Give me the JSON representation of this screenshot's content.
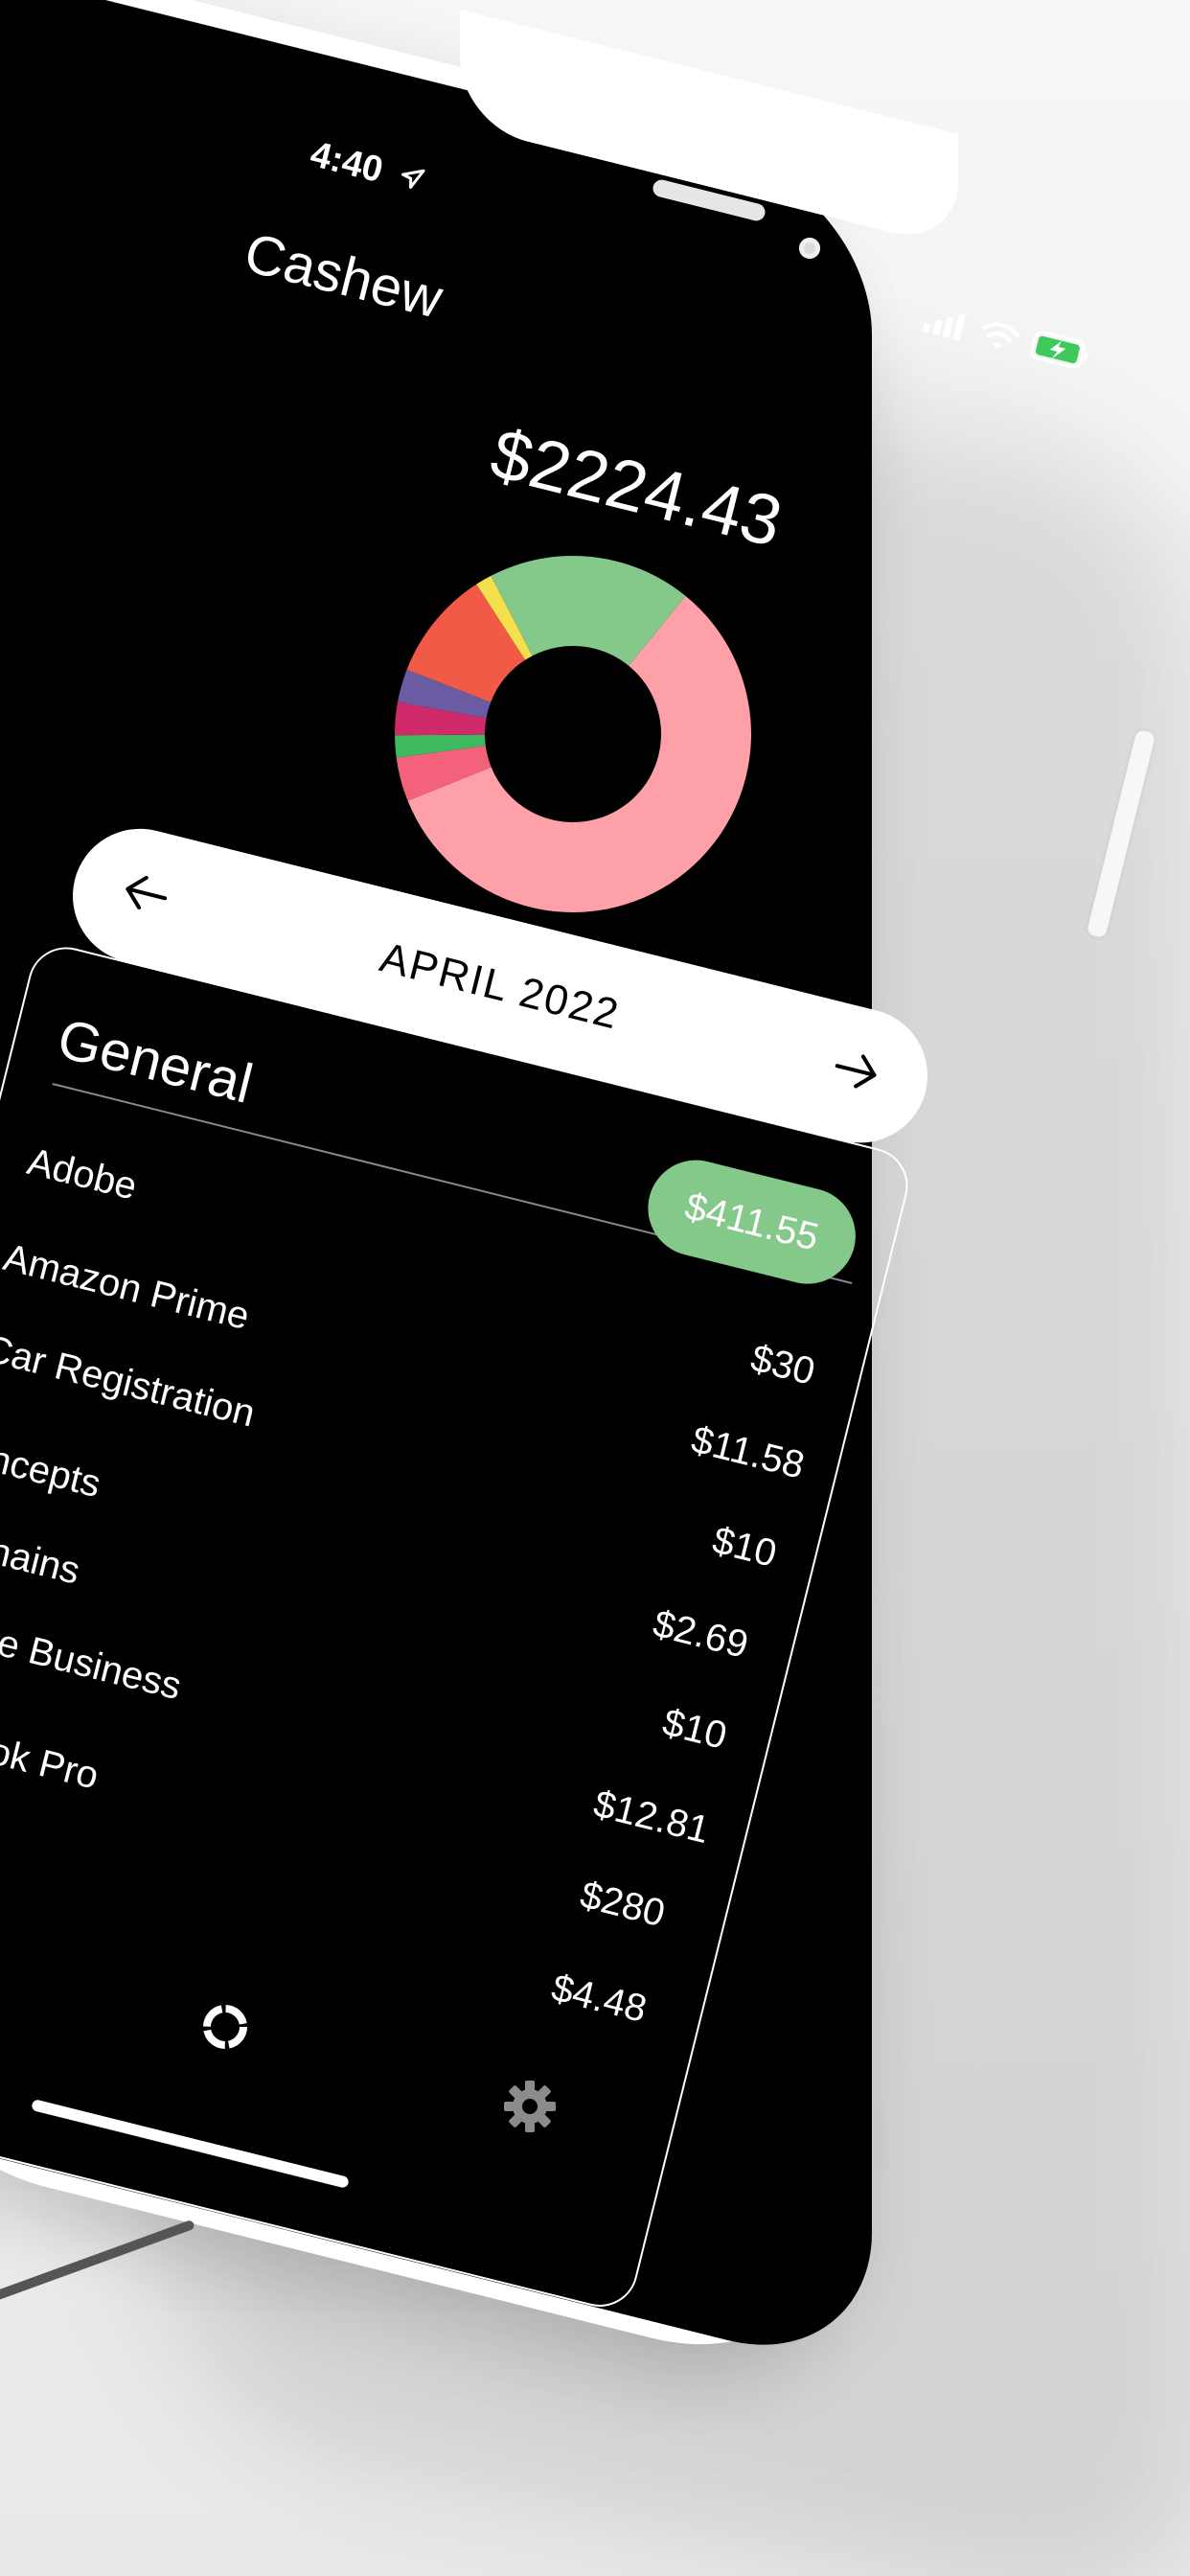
{
  "status": {
    "time": "4:40"
  },
  "app": {
    "title": "Cashew"
  },
  "summary": {
    "total": "$2224.43"
  },
  "month_nav": {
    "label": "APRIL 2022"
  },
  "category": {
    "title": "General"
  },
  "selected_amount": "$411.55",
  "rows": [
    {
      "name": "Adobe",
      "amount": "$30"
    },
    {
      "name": "Amazon Prime",
      "amount": "$11.58"
    },
    {
      "name": "Car Registration",
      "amount": "$10"
    },
    {
      "name": "ncepts",
      "amount": "$2.69"
    },
    {
      "name": "nains",
      "amount": "$10"
    },
    {
      "name": "le Business",
      "amount": "$12.81"
    },
    {
      "name": "ok Pro",
      "amount": "$280"
    },
    {
      "name": "",
      "amount": "$4.48"
    }
  ],
  "chart_data": {
    "type": "pie",
    "values": [
      0.58,
      0.04,
      0.02,
      0.03,
      0.03,
      0.1,
      0.015,
      0.185
    ],
    "colors": [
      "#fda0a7",
      "#f3627a",
      "#3fb960",
      "#d12a6a",
      "#6a5ba3",
      "#f25a48",
      "#f4e04d",
      "#84c88a"
    ]
  },
  "colors": {
    "accent_green": "#84c88a",
    "screen_bg": "#000000"
  }
}
